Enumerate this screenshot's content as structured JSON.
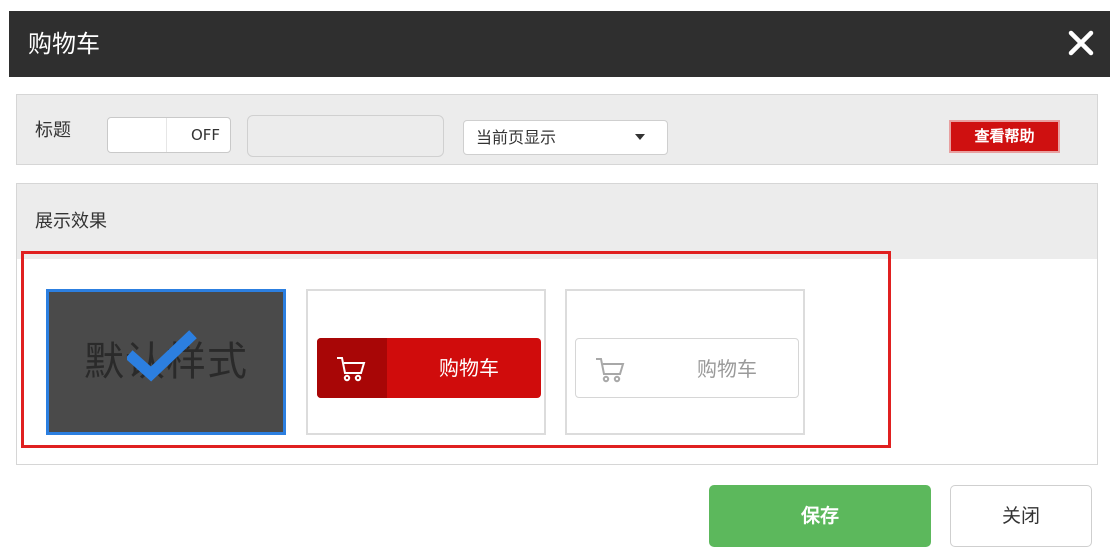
{
  "dialog": {
    "title": "购物车",
    "close_icon": "close-icon"
  },
  "toolbar": {
    "title_label": "标题",
    "toggle_state": "OFF",
    "title_input_value": "",
    "display_select_value": "当前页显示",
    "help_label": "查看帮助"
  },
  "preview": {
    "section_label": "展示效果",
    "options": [
      {
        "label": "默认样式",
        "selected": true
      },
      {
        "label": "购物车",
        "selected": false
      },
      {
        "label": "购物车",
        "selected": false
      }
    ]
  },
  "footer": {
    "save_label": "保存",
    "close_label": "关闭"
  },
  "colors": {
    "titlebar": "#2f2f2f",
    "help_red": "#cf1010",
    "cart_red": "#d00c0c",
    "selected_border": "#2c7fe0",
    "save_green": "#5cb85c",
    "highlight_red": "#e02020"
  }
}
